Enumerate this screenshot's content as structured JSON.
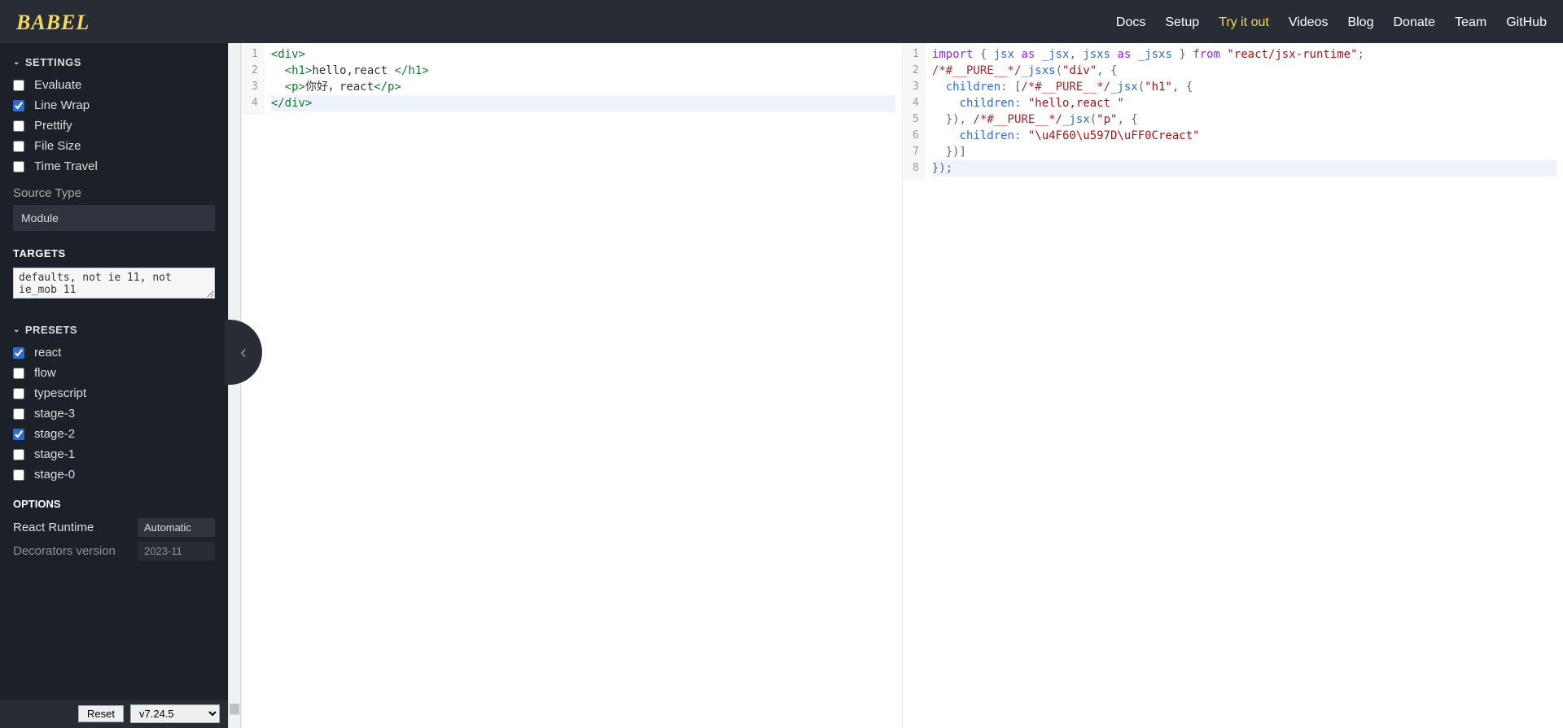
{
  "logo": "BABEL",
  "nav": {
    "docs": "Docs",
    "setup": "Setup",
    "tryitout": "Try it out",
    "videos": "Videos",
    "blog": "Blog",
    "donate": "Donate",
    "team": "Team",
    "github": "GitHub"
  },
  "sidebar": {
    "settings_header": "SETTINGS",
    "settings": {
      "evaluate": {
        "label": "Evaluate",
        "checked": false
      },
      "linewrap": {
        "label": "Line Wrap",
        "checked": true
      },
      "prettify": {
        "label": "Prettify",
        "checked": false
      },
      "filesize": {
        "label": "File Size",
        "checked": false
      },
      "timetravel": {
        "label": "Time Travel",
        "checked": false
      }
    },
    "source_type_label": "Source Type",
    "source_type_value": "Module",
    "targets_header": "TARGETS",
    "targets_value": "defaults, not ie 11, not ie_mob 11",
    "presets_header": "PRESETS",
    "presets": {
      "react": {
        "label": "react",
        "checked": true
      },
      "flow": {
        "label": "flow",
        "checked": false
      },
      "typescript": {
        "label": "typescript",
        "checked": false
      },
      "stage3": {
        "label": "stage-3",
        "checked": false
      },
      "stage2": {
        "label": "stage-2",
        "checked": true
      },
      "stage1": {
        "label": "stage-1",
        "checked": false
      },
      "stage0": {
        "label": "stage-0",
        "checked": false
      }
    },
    "options_header": "OPTIONS",
    "options": {
      "react_runtime": {
        "label": "React Runtime",
        "value": "Automatic"
      },
      "decorators": {
        "label": "Decorators version",
        "value": "2023-11"
      }
    },
    "reset_label": "Reset",
    "version": "v7.24.5"
  },
  "input_editor": {
    "lines": [
      {
        "n": "1",
        "tokens": [
          {
            "t": "tag",
            "v": "<div>"
          }
        ]
      },
      {
        "n": "2",
        "tokens": [
          {
            "t": "plain",
            "v": "  "
          },
          {
            "t": "tag",
            "v": "<h1>"
          },
          {
            "t": "plain",
            "v": "hello,react "
          },
          {
            "t": "tag",
            "v": "</h1>"
          }
        ]
      },
      {
        "n": "3",
        "tokens": [
          {
            "t": "plain",
            "v": "  "
          },
          {
            "t": "tag",
            "v": "<p>"
          },
          {
            "t": "plain",
            "v": "你好，react"
          },
          {
            "t": "tag",
            "v": "</p>"
          }
        ]
      },
      {
        "n": "4",
        "tokens": [
          {
            "t": "tag",
            "v": "</div>"
          }
        ],
        "active": true
      }
    ]
  },
  "output_editor": {
    "lines": [
      {
        "n": "1",
        "tokens": [
          {
            "t": "kw",
            "v": "import"
          },
          {
            "t": "plain",
            "v": " "
          },
          {
            "t": "punc",
            "v": "{ "
          },
          {
            "t": "id",
            "v": "jsx"
          },
          {
            "t": "plain",
            "v": " "
          },
          {
            "t": "kw",
            "v": "as"
          },
          {
            "t": "plain",
            "v": " "
          },
          {
            "t": "id",
            "v": "_jsx"
          },
          {
            "t": "punc",
            "v": ", "
          },
          {
            "t": "id",
            "v": "jsxs"
          },
          {
            "t": "plain",
            "v": " "
          },
          {
            "t": "kw",
            "v": "as"
          },
          {
            "t": "plain",
            "v": " "
          },
          {
            "t": "id",
            "v": "_jsxs"
          },
          {
            "t": "punc",
            "v": " } "
          },
          {
            "t": "kw",
            "v": "from"
          },
          {
            "t": "plain",
            "v": " "
          },
          {
            "t": "str",
            "v": "\"react/jsx-runtime\""
          },
          {
            "t": "punc",
            "v": ";"
          }
        ]
      },
      {
        "n": "2",
        "tokens": [
          {
            "t": "cmt",
            "v": "/*#__PURE__*/"
          },
          {
            "t": "id",
            "v": "_jsxs"
          },
          {
            "t": "punc",
            "v": "("
          },
          {
            "t": "str",
            "v": "\"div\""
          },
          {
            "t": "punc",
            "v": ", {"
          }
        ]
      },
      {
        "n": "3",
        "tokens": [
          {
            "t": "plain",
            "v": "  "
          },
          {
            "t": "id",
            "v": "children"
          },
          {
            "t": "punc",
            "v": ": ["
          },
          {
            "t": "cmt",
            "v": "/*#__PURE__*/"
          },
          {
            "t": "id",
            "v": "_jsx"
          },
          {
            "t": "punc",
            "v": "("
          },
          {
            "t": "str",
            "v": "\"h1\""
          },
          {
            "t": "punc",
            "v": ", {"
          }
        ]
      },
      {
        "n": "4",
        "tokens": [
          {
            "t": "plain",
            "v": "    "
          },
          {
            "t": "id",
            "v": "children"
          },
          {
            "t": "punc",
            "v": ": "
          },
          {
            "t": "str",
            "v": "\"hello,react \""
          }
        ]
      },
      {
        "n": "5",
        "tokens": [
          {
            "t": "plain",
            "v": "  "
          },
          {
            "t": "punc",
            "v": "}), "
          },
          {
            "t": "cmt",
            "v": "/*#__PURE__*/"
          },
          {
            "t": "id",
            "v": "_jsx"
          },
          {
            "t": "punc",
            "v": "("
          },
          {
            "t": "str",
            "v": "\"p\""
          },
          {
            "t": "punc",
            "v": ", {"
          }
        ]
      },
      {
        "n": "6",
        "tokens": [
          {
            "t": "plain",
            "v": "    "
          },
          {
            "t": "id",
            "v": "children"
          },
          {
            "t": "punc",
            "v": ": "
          },
          {
            "t": "str",
            "v": "\"\\u4F60\\u597D\\uFF0Creact\""
          }
        ]
      },
      {
        "n": "7",
        "tokens": [
          {
            "t": "plain",
            "v": "  "
          },
          {
            "t": "punc",
            "v": "})]"
          }
        ]
      },
      {
        "n": "8",
        "tokens": [
          {
            "t": "punc",
            "v": "});"
          }
        ],
        "active": true
      }
    ]
  }
}
